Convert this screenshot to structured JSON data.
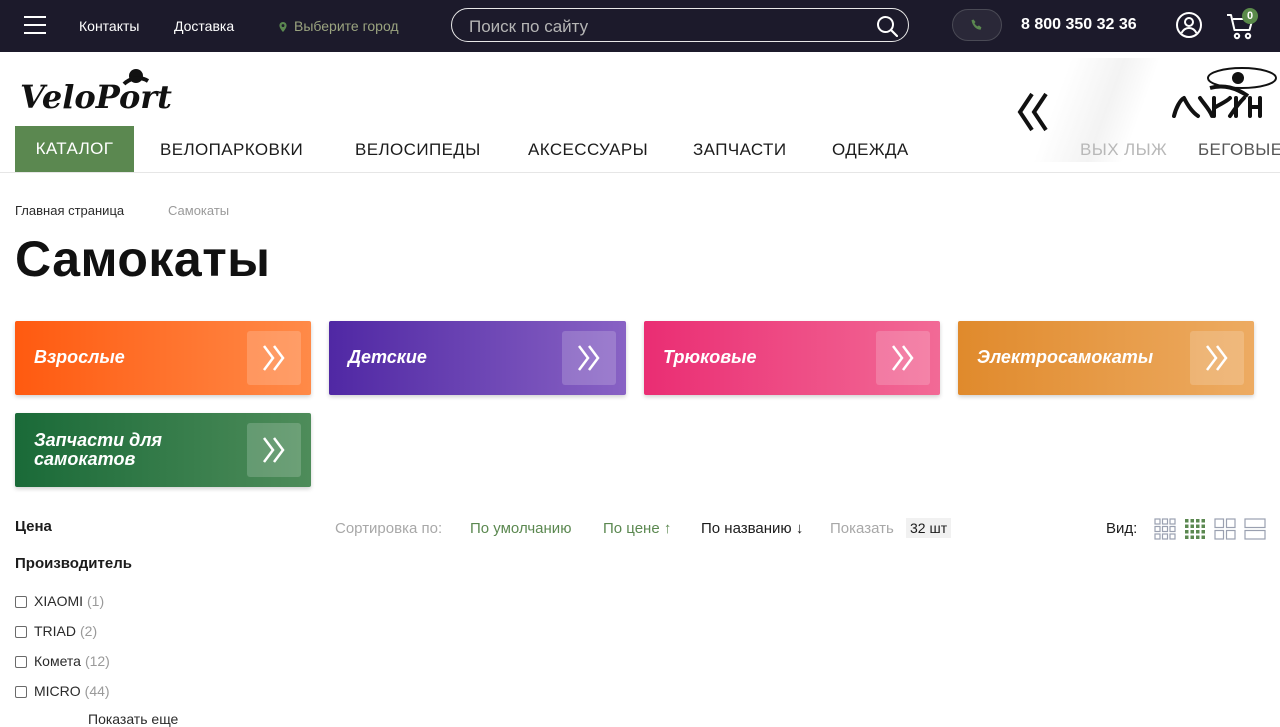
{
  "topbar": {
    "links": [
      "Контакты",
      "Доставка"
    ],
    "city": "Выберите город",
    "search_placeholder": "Поиск по сайту",
    "phone": "8 800 350 32 36",
    "cart_count": "0"
  },
  "logo": "VeloPort",
  "nav": {
    "catalog": "КАТАЛОГ",
    "items": [
      "ВЕЛОПАРКОВКИ",
      "ВЕЛОСИПЕДЫ",
      "АКСЕССУАРЫ",
      "ЗАПЧАСТИ",
      "ОДЕЖДА"
    ],
    "faded": [
      "ВЫХ ЛЫЖ",
      "БЕГОВЫЕ"
    ]
  },
  "breadcrumb": {
    "home": "Главная страница",
    "current": "Самокаты"
  },
  "title": "Самокаты",
  "categories": [
    {
      "label": "Взрослые",
      "color": "#ff5a10"
    },
    {
      "label": "Детские",
      "color": "#5a2fa8"
    },
    {
      "label": "Трюковые",
      "color": "#ec3578"
    },
    {
      "label": "Электросамокаты",
      "color": "#e08a30"
    },
    {
      "label_l1": "Запчасти для",
      "label_l2": "самокатов",
      "color": "#1e6b3a"
    }
  ],
  "filter": {
    "price": "Цена",
    "manufacturer": "Производитель",
    "brands": [
      {
        "name": "XIAOMI",
        "count": "(1)"
      },
      {
        "name": "TRIAD",
        "count": "(2)"
      },
      {
        "name": "Комета",
        "count": "(12)"
      },
      {
        "name": "MICRO",
        "count": "(44)"
      }
    ],
    "show_more": "Показать еще"
  },
  "sort": {
    "label": "Сортировка по:",
    "options": [
      "По умолчанию",
      "По цене ↑",
      "По названию ↓"
    ],
    "show_label": "Показать",
    "show_value": "32 шт",
    "view_label": "Вид:"
  },
  "colors": {
    "topbar": "#1c1a2b",
    "accent": "#5b8850"
  }
}
